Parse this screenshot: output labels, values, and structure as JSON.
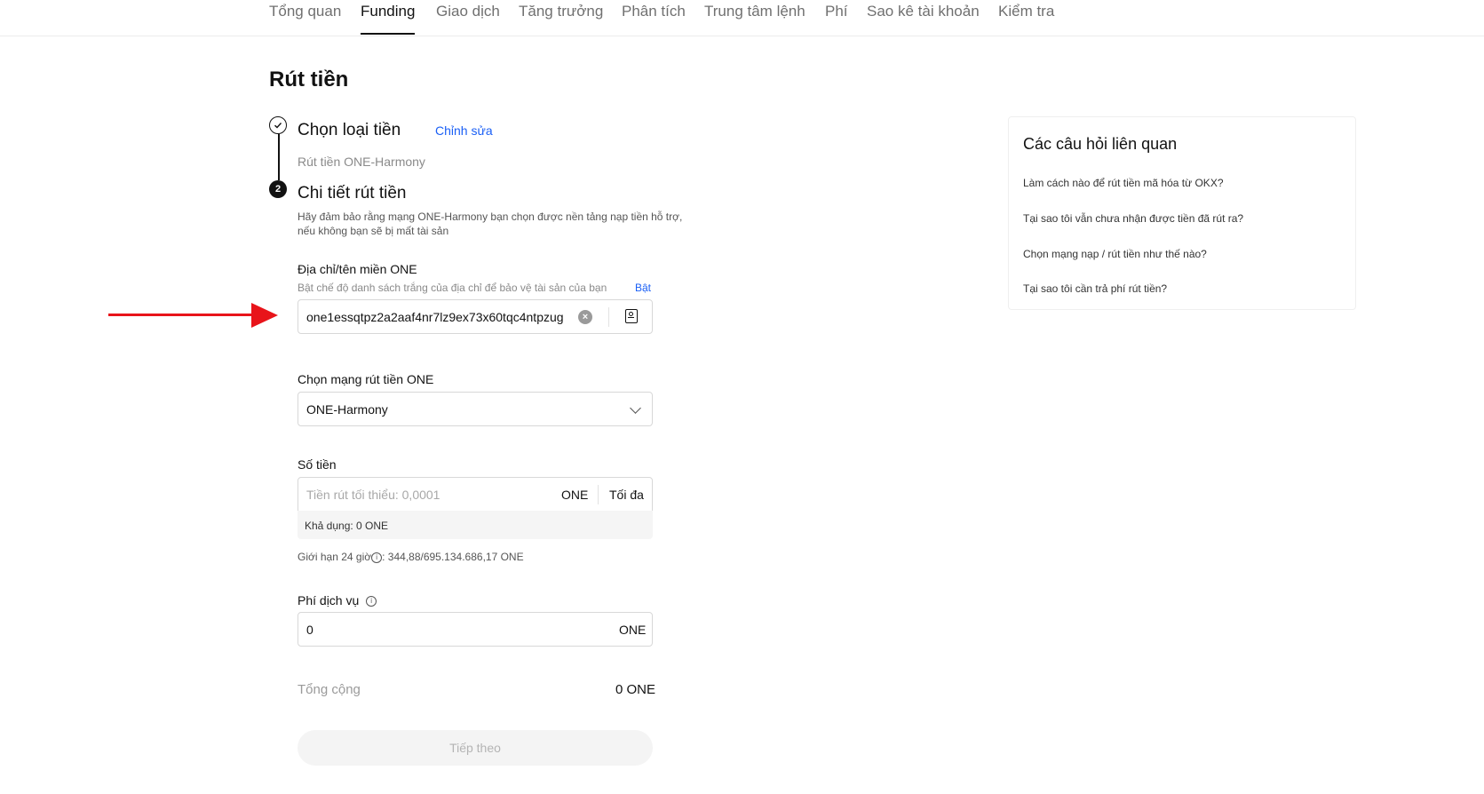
{
  "nav": {
    "tabs": [
      {
        "label": "Tổng quan"
      },
      {
        "label": "Funding"
      },
      {
        "label": "Giao dịch"
      },
      {
        "label": "Tăng trưởng"
      },
      {
        "label": "Phân tích"
      },
      {
        "label": "Trung tâm lệnh"
      },
      {
        "label": "Phí"
      },
      {
        "label": "Sao kê tài khoản"
      },
      {
        "label": "Kiểm tra"
      }
    ],
    "active_tab": "Funding"
  },
  "page": {
    "title": "Rút tiền"
  },
  "steps": {
    "step1": {
      "title": "Chọn loại tiền",
      "edit_link": "Chỉnh sửa",
      "summary": "Rút tiền ONE-Harmony"
    },
    "step2": {
      "number": "2",
      "title": "Chi tiết rút tiền",
      "warning_line1": "Hãy đảm bảo rằng mạng ONE-Harmony bạn chọn được nền tảng nạp tiền hỗ trợ,",
      "warning_line2": "nếu không bạn sẽ bị mất tài sản"
    }
  },
  "address": {
    "label": "Địa chỉ/tên miền ONE",
    "whitelist_hint": "Bật chế độ danh sách trắng của địa chỉ để bảo vệ tài sản của bạn",
    "whitelist_link": "Bật",
    "value": "one1essqtpz2a2aaf4nr7lz9ex73x60tqc4ntpzug"
  },
  "network": {
    "label": "Chọn mạng rút tiền ONE",
    "selected": "ONE-Harmony"
  },
  "amount": {
    "label": "Số tiền",
    "placeholder": "Tiền rút tối thiểu: 0,0001",
    "unit": "ONE",
    "max_label": "Tối đa",
    "available": "Khả dụng: 0 ONE",
    "limit_label": "Giới hạn 24 giờ",
    "limit_value": ": 344,88/695.134.686,17 ONE"
  },
  "fee": {
    "label": "Phí dịch vụ",
    "value": "0",
    "unit": "ONE"
  },
  "total": {
    "label": "Tổng cộng",
    "value": "0 ONE"
  },
  "next_button": "Tiếp theo",
  "faq": {
    "title": "Các câu hỏi liên quan",
    "items": [
      "Làm cách nào để rút tiền mã hóa từ OKX?",
      "Tại sao tôi vẫn chưa nhận được tiền đã rút ra?",
      "Chọn mạng nạp / rút tiền như thế nào?",
      "Tại sao tôi cần trả phí rút tiền?"
    ]
  },
  "colors": {
    "accent_link": "#1a5ff5",
    "annotation_arrow": "#e8141a",
    "text_primary": "#121212"
  }
}
